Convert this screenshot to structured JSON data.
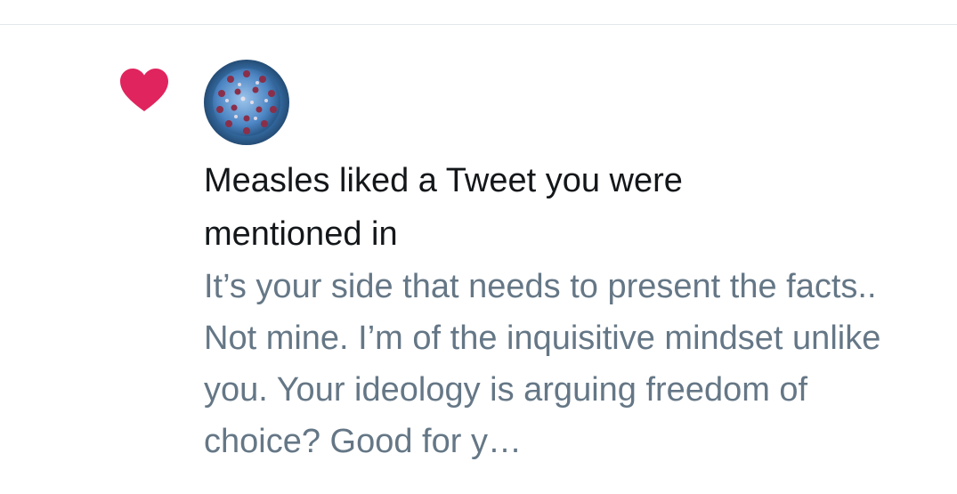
{
  "notification": {
    "type_icon": "heart-icon",
    "accent_color": "#e0245e",
    "avatar_icon": "virus-avatar",
    "headline": "Measles liked a Tweet you were mentioned in",
    "tweet_preview": "It’s your side that needs to present the facts.. Not mine. I’m of the inquisitive mindset unlike you. Your ideology is arguing freedom of choice? Good for y…",
    "text_color": "#14171a",
    "secondary_text_color": "#657786"
  }
}
